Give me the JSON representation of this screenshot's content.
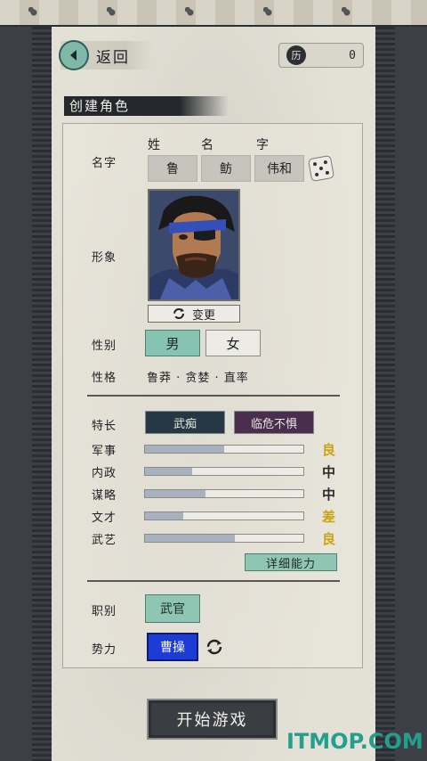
{
  "header": {
    "back_label": "返回",
    "coin_symbol": "历",
    "coin_value": "0"
  },
  "title": "创建角色",
  "name_section": {
    "label": "名字",
    "headers": [
      "姓",
      "名",
      "字"
    ],
    "values": [
      "鲁",
      "鲂",
      "伟和"
    ]
  },
  "appearance": {
    "label": "形象",
    "change_label": "变更"
  },
  "gender": {
    "label": "性别",
    "options": [
      "男",
      "女"
    ],
    "selected": "男"
  },
  "personality": {
    "label": "性格",
    "text": "鲁莽 · 贪婪 · 直率"
  },
  "specialty": {
    "label": "特长",
    "tags": [
      {
        "text": "武痴",
        "color": "#263844"
      },
      {
        "text": "临危不惧",
        "color": "#4b2e4d"
      }
    ]
  },
  "stats": [
    {
      "label": "军事",
      "fraction": 0.5,
      "grade": "良",
      "grade_color": "#c9a412"
    },
    {
      "label": "内政",
      "fraction": 0.3,
      "grade": "中",
      "grade_color": "#2a2a2a"
    },
    {
      "label": "谋略",
      "fraction": 0.38,
      "grade": "中",
      "grade_color": "#2a2a2a"
    },
    {
      "label": "文才",
      "fraction": 0.24,
      "grade": "差",
      "grade_color": "#c9a412"
    },
    {
      "label": "武艺",
      "fraction": 0.57,
      "grade": "良",
      "grade_color": "#c9a412"
    }
  ],
  "detail_button": "详细能力",
  "post": {
    "label": "职别",
    "value": "武官"
  },
  "faction": {
    "label": "势力",
    "value": "曹操"
  },
  "start_button": "开始游戏",
  "watermark": "ITMOP.COM",
  "colors": {
    "accent_teal": "#8fc5b3",
    "faction_blue": "#1d3bd6",
    "grade_gold": "#c9a412"
  }
}
